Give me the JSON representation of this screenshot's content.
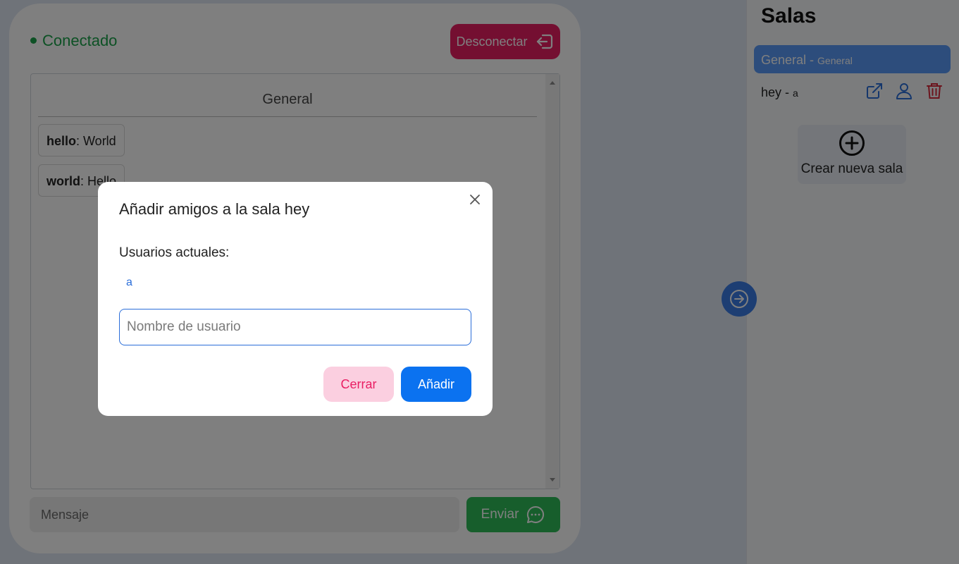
{
  "chat": {
    "status_label": "Conectado",
    "disconnect_label": "Desconectar",
    "room_title": "General",
    "messages": [
      {
        "user": "hello",
        "text": ": World"
      },
      {
        "user": "world",
        "text": ": Hello"
      }
    ],
    "message_placeholder": "Mensaje",
    "send_label": "Enviar"
  },
  "sidebar": {
    "title": "Salas",
    "rooms": [
      {
        "name": "General",
        "sep": " - ",
        "owner": "General",
        "active": true
      },
      {
        "name": "hey",
        "sep": " - ",
        "owner": "a",
        "active": false
      }
    ],
    "create_label": "Crear nueva sala"
  },
  "modal": {
    "title": "Añadir amigos a la sala hey",
    "users_label": "Usuarios actuales:",
    "users": [
      "a"
    ],
    "input_placeholder": "Nombre de usuario",
    "close_label": "Cerrar",
    "add_label": "Añadir"
  },
  "colors": {
    "status_green": "#1aa34a",
    "disconnect": "#e91e63",
    "send": "#2ebd59",
    "active_room": "#5b9bf8",
    "primary": "#0b72f0",
    "delete_red": "#d9283a"
  },
  "icons": [
    "logout-icon",
    "chat-bubble-icon",
    "external-link-icon",
    "user-icon",
    "trash-icon",
    "plus-circle-icon",
    "arrow-right-circle-icon",
    "close-icon"
  ]
}
